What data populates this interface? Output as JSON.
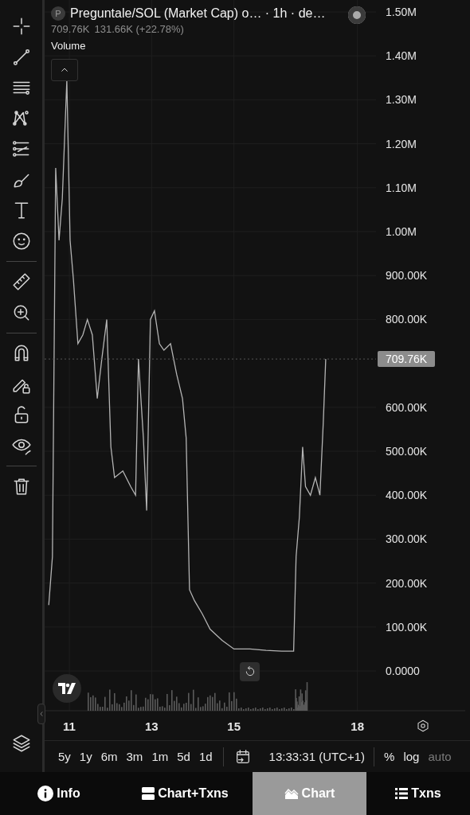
{
  "legend": {
    "symbol_letter": "P",
    "title": "Preguntale/SOL (Market Cap) o… · 1h · de…",
    "last_value": "709.76K",
    "change": "131.66K (+22.78%)",
    "study": "Volume"
  },
  "chart": {
    "chart_data": {
      "type": "line",
      "x": [
        10.5,
        10.59,
        10.67,
        10.75,
        10.83,
        10.94,
        11.02,
        11.1,
        11.21,
        11.33,
        11.44,
        11.56,
        11.68,
        11.79,
        11.91,
        12.01,
        12.1,
        12.3,
        12.49,
        12.61,
        12.68,
        12.8,
        12.88,
        12.97,
        13.07,
        13.19,
        13.3,
        13.46,
        13.61,
        13.75,
        13.84,
        13.92,
        14.04,
        14.23,
        14.42,
        14.71,
        15.0,
        15.39,
        15.78,
        16.16,
        16.45,
        16.51,
        16.59,
        16.67,
        16.74,
        16.86,
        16.98,
        17.09,
        17.17,
        17.23
      ],
      "series": [
        {
          "color": "#b4b4b4",
          "values": [
            150000,
            260000,
            1145000,
            980000,
            1075000,
            1345000,
            980000,
            890000,
            745000,
            765000,
            800000,
            765000,
            620000,
            710000,
            800000,
            510000,
            440000,
            455000,
            420000,
            400000,
            710000,
            530000,
            365000,
            800000,
            820000,
            745000,
            730000,
            745000,
            675000,
            620000,
            530000,
            185000,
            160000,
            130000,
            95000,
            70000,
            50000,
            50000,
            47000,
            45000,
            45000,
            260000,
            350000,
            510000,
            420000,
            400000,
            440000,
            400000,
            565000,
            710000
          ]
        }
      ],
      "xlim": [
        10.4,
        20.62
      ],
      "ylim": [
        0,
        1500000
      ],
      "xticks": [
        11,
        13,
        15,
        18
      ],
      "yticks": [
        {
          "value": 0,
          "label": "0.0000"
        },
        {
          "value": 100000,
          "label": "100.00K"
        },
        {
          "value": 200000,
          "label": "200.00K"
        },
        {
          "value": 300000,
          "label": "300.00K"
        },
        {
          "value": 400000,
          "label": "400.00K"
        },
        {
          "value": 500000,
          "label": "500.00K"
        },
        {
          "value": 600000,
          "label": "600.00K"
        },
        {
          "value": 800000,
          "label": "800.00K"
        },
        {
          "value": 900000,
          "label": "900.00K"
        },
        {
          "value": 1000000,
          "label": "1.00M"
        },
        {
          "value": 1100000,
          "label": "1.10M"
        },
        {
          "value": 1200000,
          "label": "1.20M"
        },
        {
          "value": 1300000,
          "label": "1.30M"
        },
        {
          "value": 1400000,
          "label": "1.40M"
        },
        {
          "value": 1500000,
          "label": "1.50M"
        }
      ],
      "grid": true
    },
    "last_price_label": "709.76K"
  },
  "ranges": [
    {
      "label": "5y"
    },
    {
      "label": "1y"
    },
    {
      "label": "6m"
    },
    {
      "label": "3m"
    },
    {
      "label": "1m"
    },
    {
      "label": "5d"
    },
    {
      "label": "1d"
    }
  ],
  "clock": "13:33:31 (UTC+1)",
  "scale_toggles": [
    {
      "label": "%",
      "disabled": false
    },
    {
      "label": "log",
      "disabled": false
    },
    {
      "label": "auto",
      "disabled": true
    }
  ],
  "nav_tabs": [
    {
      "label": "Info",
      "selected": false
    },
    {
      "label": "Chart+Txns",
      "selected": false
    },
    {
      "label": "Chart",
      "selected": true
    },
    {
      "label": "Txns",
      "selected": false
    }
  ]
}
